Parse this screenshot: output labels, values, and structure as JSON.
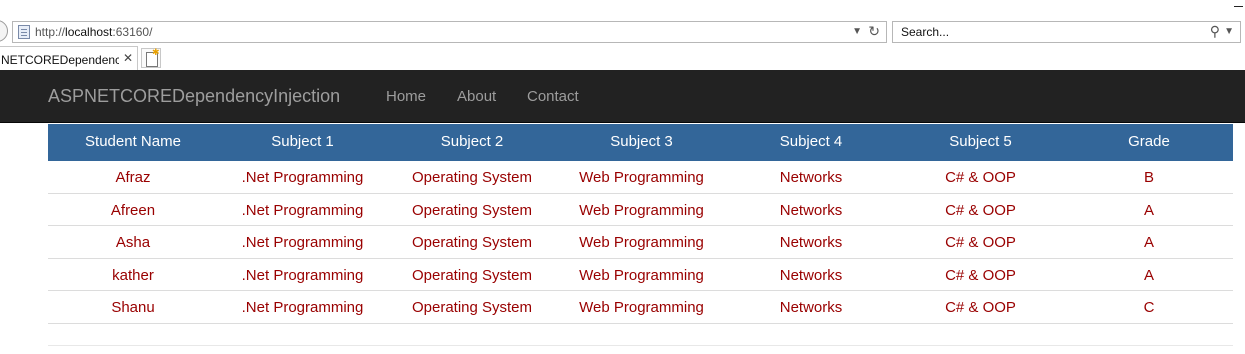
{
  "browser": {
    "url_prefix": "http://",
    "url_host": "localhost",
    "url_port": ":63160/",
    "search_placeholder": "Search...",
    "tab_title": "NETCOREDependency...",
    "tab_close": "✕"
  },
  "navbar": {
    "brand": "ASPNETCOREDependencyInjection",
    "links": [
      "Home",
      "About",
      "Contact"
    ]
  },
  "table": {
    "headers": [
      "Student Name",
      "Subject 1",
      "Subject 2",
      "Subject 3",
      "Subject 4",
      "Subject 5",
      "Grade"
    ],
    "rows": [
      [
        "Afraz",
        ".Net Programming",
        "Operating System",
        "Web Programming",
        "Networks",
        "C# & OOP",
        "B"
      ],
      [
        "Afreen",
        ".Net Programming",
        "Operating System",
        "Web Programming",
        "Networks",
        "C# & OOP",
        "A"
      ],
      [
        "Asha",
        ".Net Programming",
        "Operating System",
        "Web Programming",
        "Networks",
        "C# & OOP",
        "A"
      ],
      [
        "kather",
        ".Net Programming",
        "Operating System",
        "Web Programming",
        "Networks",
        "C# & OOP",
        "A"
      ],
      [
        "Shanu",
        ".Net Programming",
        "Operating System",
        "Web Programming",
        "Networks",
        "C# & OOP",
        "C"
      ]
    ]
  },
  "colors": {
    "navbar_bg": "#222222",
    "header_bg": "#336699",
    "cell_text": "#990000"
  }
}
